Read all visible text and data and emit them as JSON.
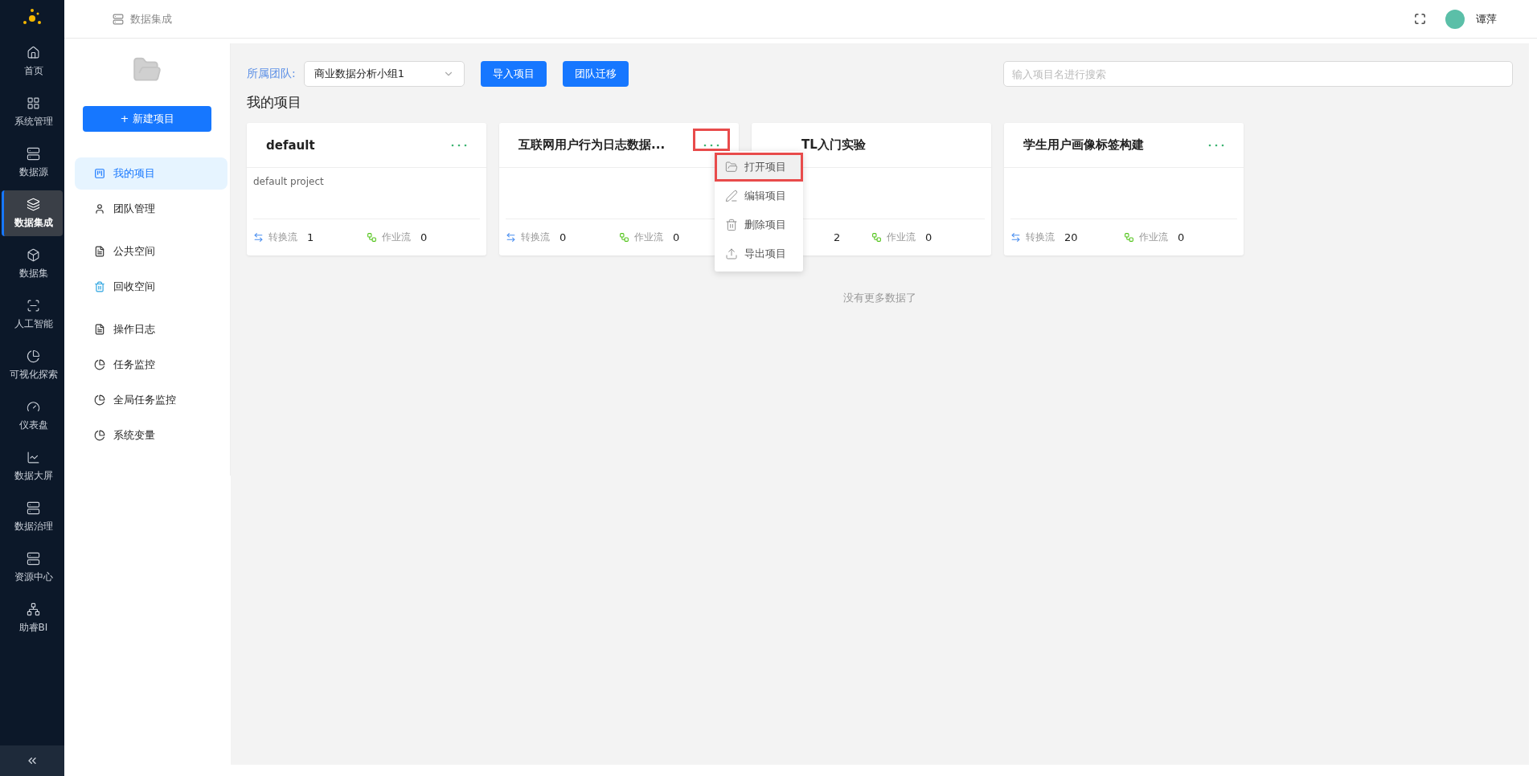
{
  "nav": {
    "items": [
      {
        "label": "首页",
        "selected": false
      },
      {
        "label": "系统管理",
        "selected": false
      },
      {
        "label": "数据源",
        "selected": false
      },
      {
        "label": "数据集成",
        "selected": true
      },
      {
        "label": "数据集",
        "selected": false
      },
      {
        "label": "人工智能",
        "selected": false
      },
      {
        "label": "可视化探索",
        "selected": false
      },
      {
        "label": "仪表盘",
        "selected": false
      },
      {
        "label": "数据大屏",
        "selected": false
      },
      {
        "label": "数据治理",
        "selected": false
      },
      {
        "label": "资源中心",
        "selected": false
      },
      {
        "label": "助睿BI",
        "selected": false
      }
    ]
  },
  "topbar": {
    "breadcrumb": "数据集成",
    "user": "谭萍"
  },
  "sidebar": {
    "new_button": "+ 新建项目",
    "items": [
      {
        "label": "我的项目",
        "selected": true
      },
      {
        "label": "团队管理",
        "selected": false
      },
      {
        "label": "公共空间",
        "selected": false
      },
      {
        "label": "回收空间",
        "selected": false
      },
      {
        "label": "操作日志",
        "selected": false
      },
      {
        "label": "任务监控",
        "selected": false
      },
      {
        "label": "全局任务监控",
        "selected": false
      },
      {
        "label": "系统变量",
        "selected": false
      }
    ]
  },
  "toolbar": {
    "team_label": "所属团队:",
    "team_value": "商业数据分析小组1",
    "buttons": [
      "导入项目",
      "团队迁移"
    ],
    "search": {
      "placeholder": "输入项目名进行搜索"
    }
  },
  "section_title": "我的项目",
  "projects": [
    {
      "title": "default",
      "description": "default project",
      "covered": false,
      "stats": [
        {
          "kind": "transform",
          "label": "转换流",
          "value": "1"
        },
        {
          "kind": "job",
          "label": "作业流",
          "value": "0"
        }
      ]
    },
    {
      "title": "互联网用户行为日志数据...",
      "covered": false,
      "stats": [
        {
          "kind": "transform",
          "label": "转换流",
          "value": "0"
        },
        {
          "kind": "job",
          "label": "作业流",
          "value": "0"
        }
      ]
    },
    {
      "title": "TL入门实验",
      "covered": true,
      "stats": [
        {
          "value": "2"
        },
        {
          "kind": "job",
          "label": "作业流",
          "value": "0"
        }
      ]
    },
    {
      "title": "学生用户画像标签构建",
      "covered": false,
      "stats": [
        {
          "kind": "transform",
          "label": "转换流",
          "value": "20"
        },
        {
          "kind": "job",
          "label": "作业流",
          "value": "0"
        }
      ]
    }
  ],
  "menu": {
    "items": [
      {
        "label": "打开项目",
        "selected": true
      },
      {
        "label": "编辑项目",
        "selected": false
      },
      {
        "label": "删除项目",
        "selected": false
      },
      {
        "label": "导出项目",
        "selected": false
      }
    ]
  },
  "end_text": "没有更多数据了"
}
